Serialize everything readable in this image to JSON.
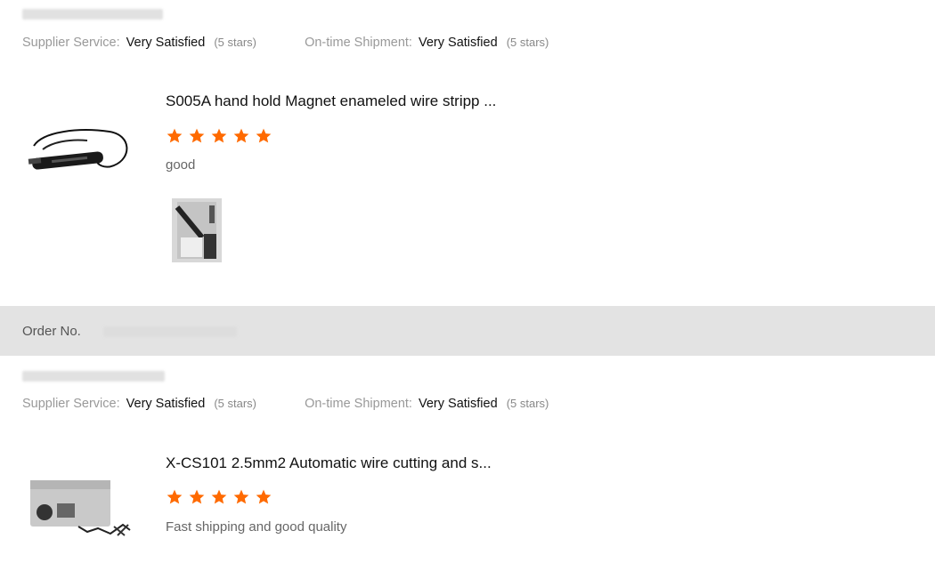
{
  "reviews": [
    {
      "supplier_label": "Supplier Service:",
      "supplier_value": "Very Satisfied",
      "supplier_stars": "(5 stars)",
      "shipment_label": "On-time Shipment:",
      "shipment_value": "Very Satisfied",
      "shipment_stars": "(5 stars)",
      "product_title": "S005A hand hold Magnet enameled wire stripp ...",
      "rating": 5,
      "comment": "good",
      "has_photo": true
    },
    {
      "supplier_label": "Supplier Service:",
      "supplier_value": "Very Satisfied",
      "supplier_stars": "(5 stars)",
      "shipment_label": "On-time Shipment:",
      "shipment_value": "Very Satisfied",
      "shipment_stars": "(5 stars)",
      "product_title": "X-CS101 2.5mm2 Automatic wire cutting and s...",
      "rating": 5,
      "comment": "Fast shipping and good quality"
    }
  ],
  "order_bar": {
    "label": "Order No."
  },
  "colors": {
    "star": "#ff6a00",
    "order_bar_bg": "#e3e3e3"
  }
}
